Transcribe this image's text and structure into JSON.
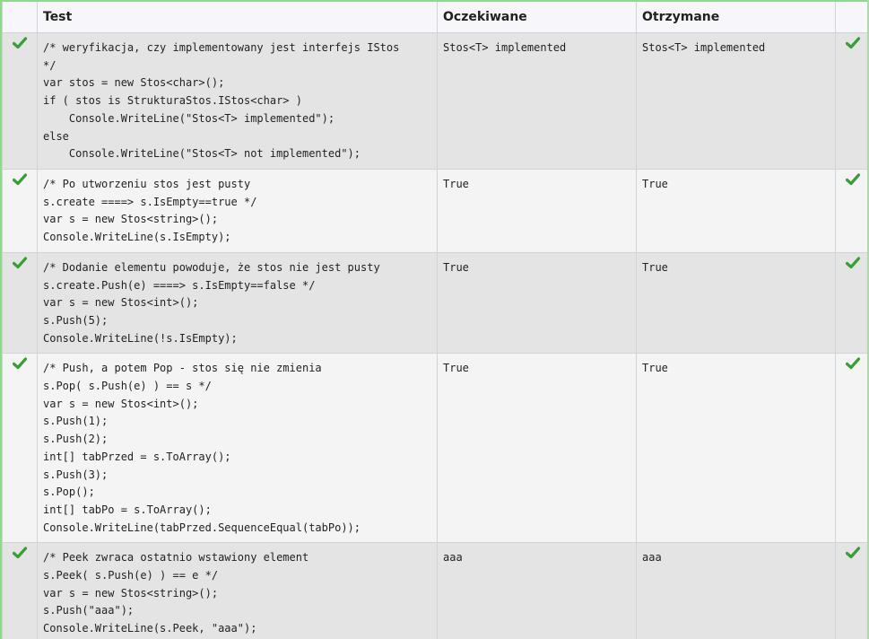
{
  "header": {
    "test": "Test",
    "expected": "Oczekiwane",
    "got": "Otrzymane"
  },
  "colors": {
    "check": "#35a035",
    "row_odd": "#e4e4e4",
    "row_even": "#f4f4f4",
    "frame": "#a6e0a0"
  },
  "rows": [
    {
      "status_icon": "check-icon",
      "code": "/* weryfikacja, czy implementowany jest interfejs IStos\n*/\nvar stos = new Stos<char>();\nif ( stos is StrukturaStos.IStos<char> )\n    Console.WriteLine(\"Stos<T> implemented\");\nelse\n    Console.WriteLine(\"Stos<T> not implemented\");",
      "expected": "Stos<T> implemented",
      "got": "Stos<T> implemented"
    },
    {
      "status_icon": "check-icon",
      "code": "/* Po utworzeniu stos jest pusty\ns.create ====> s.IsEmpty==true */\nvar s = new Stos<string>();\nConsole.WriteLine(s.IsEmpty);",
      "expected": "True",
      "got": "True"
    },
    {
      "status_icon": "check-icon",
      "code": "/* Dodanie elementu powoduje, że stos nie jest pusty\ns.create.Push(e) ====> s.IsEmpty==false */\nvar s = new Stos<int>();\ns.Push(5);\nConsole.WriteLine(!s.IsEmpty);",
      "expected": "True",
      "got": "True"
    },
    {
      "status_icon": "check-icon",
      "code": "/* Push, a potem Pop - stos się nie zmienia\ns.Pop( s.Push(e) ) == s */\nvar s = new Stos<int>();\ns.Push(1);\ns.Push(2);\nint[] tabPrzed = s.ToArray();\ns.Push(3);\ns.Pop();\nint[] tabPo = s.ToArray();\nConsole.WriteLine(tabPrzed.SequenceEqual(tabPo));",
      "expected": "True",
      "got": "True"
    },
    {
      "status_icon": "check-icon",
      "code": "/* Peek zwraca ostatnio wstawiony element\ns.Peek( s.Push(e) ) == e */\nvar s = new Stos<string>();\ns.Push(\"aaa\");\nConsole.WriteLine(s.Peek, \"aaa\");",
      "expected": "aaa",
      "got": "aaa"
    }
  ]
}
